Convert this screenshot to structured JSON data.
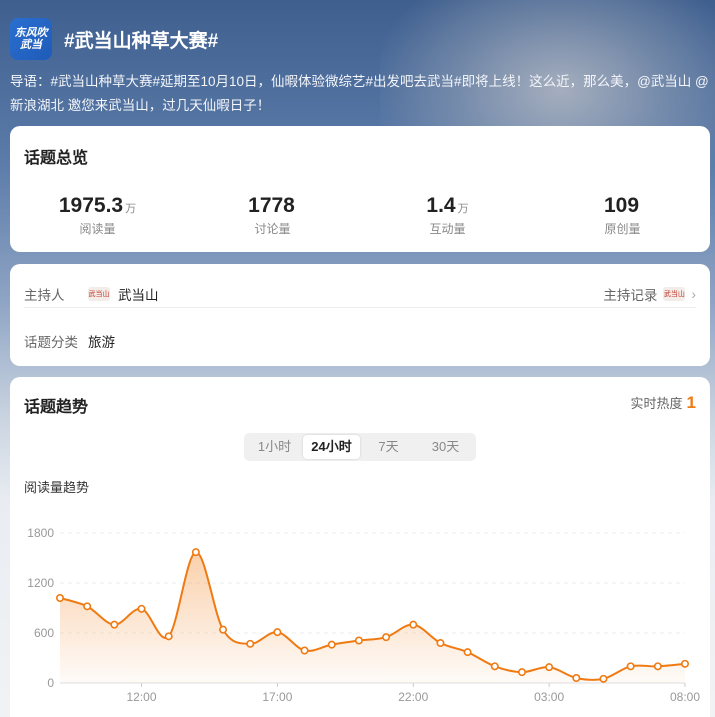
{
  "header": {
    "logo_text": "东风吹武当",
    "title": "#武当山种草大赛#"
  },
  "intro": "导语：#武当山种草大赛#延期至10月10日，仙暇体验微综艺#出发吧去武当#即将上线！这么近，那么美，@武当山 @新浪湖北 邀您来武当山，过几天仙暇日子！",
  "overview": {
    "title": "话题总览",
    "stats": [
      {
        "value": "1975.3",
        "unit": "万",
        "label": "阅读量"
      },
      {
        "value": "1778",
        "unit": "",
        "label": "讨论量"
      },
      {
        "value": "1.4",
        "unit": "万",
        "label": "互动量"
      },
      {
        "value": "109",
        "unit": "",
        "label": "原创量"
      }
    ]
  },
  "host": {
    "label": "主持人",
    "name": "武当山",
    "avatar_text": "武当山",
    "record_label": "主持记录",
    "category_label": "话题分类",
    "category_value": "旅游"
  },
  "trend": {
    "title": "话题趋势",
    "heat_label": "实时热度",
    "heat_value": "1",
    "tabs": [
      "1小时",
      "24小时",
      "7天",
      "30天"
    ],
    "active_tab": 1,
    "subtitle": "阅读量趋势"
  },
  "colors": {
    "accent": "#f07a12",
    "line": "#f07a12"
  },
  "chart_data": {
    "type": "area",
    "x_tick_labels": [
      "12:00",
      "17:00",
      "22:00",
      "03:00",
      "08:00"
    ],
    "y_ticks": [
      0,
      600,
      1200,
      1800
    ],
    "ylim": [
      0,
      1800
    ],
    "values": [
      1020,
      920,
      700,
      890,
      560,
      1570,
      640,
      470,
      610,
      390,
      460,
      510,
      550,
      700,
      480,
      370,
      200,
      130,
      190,
      60,
      50,
      200,
      200,
      230
    ],
    "grid": true
  }
}
